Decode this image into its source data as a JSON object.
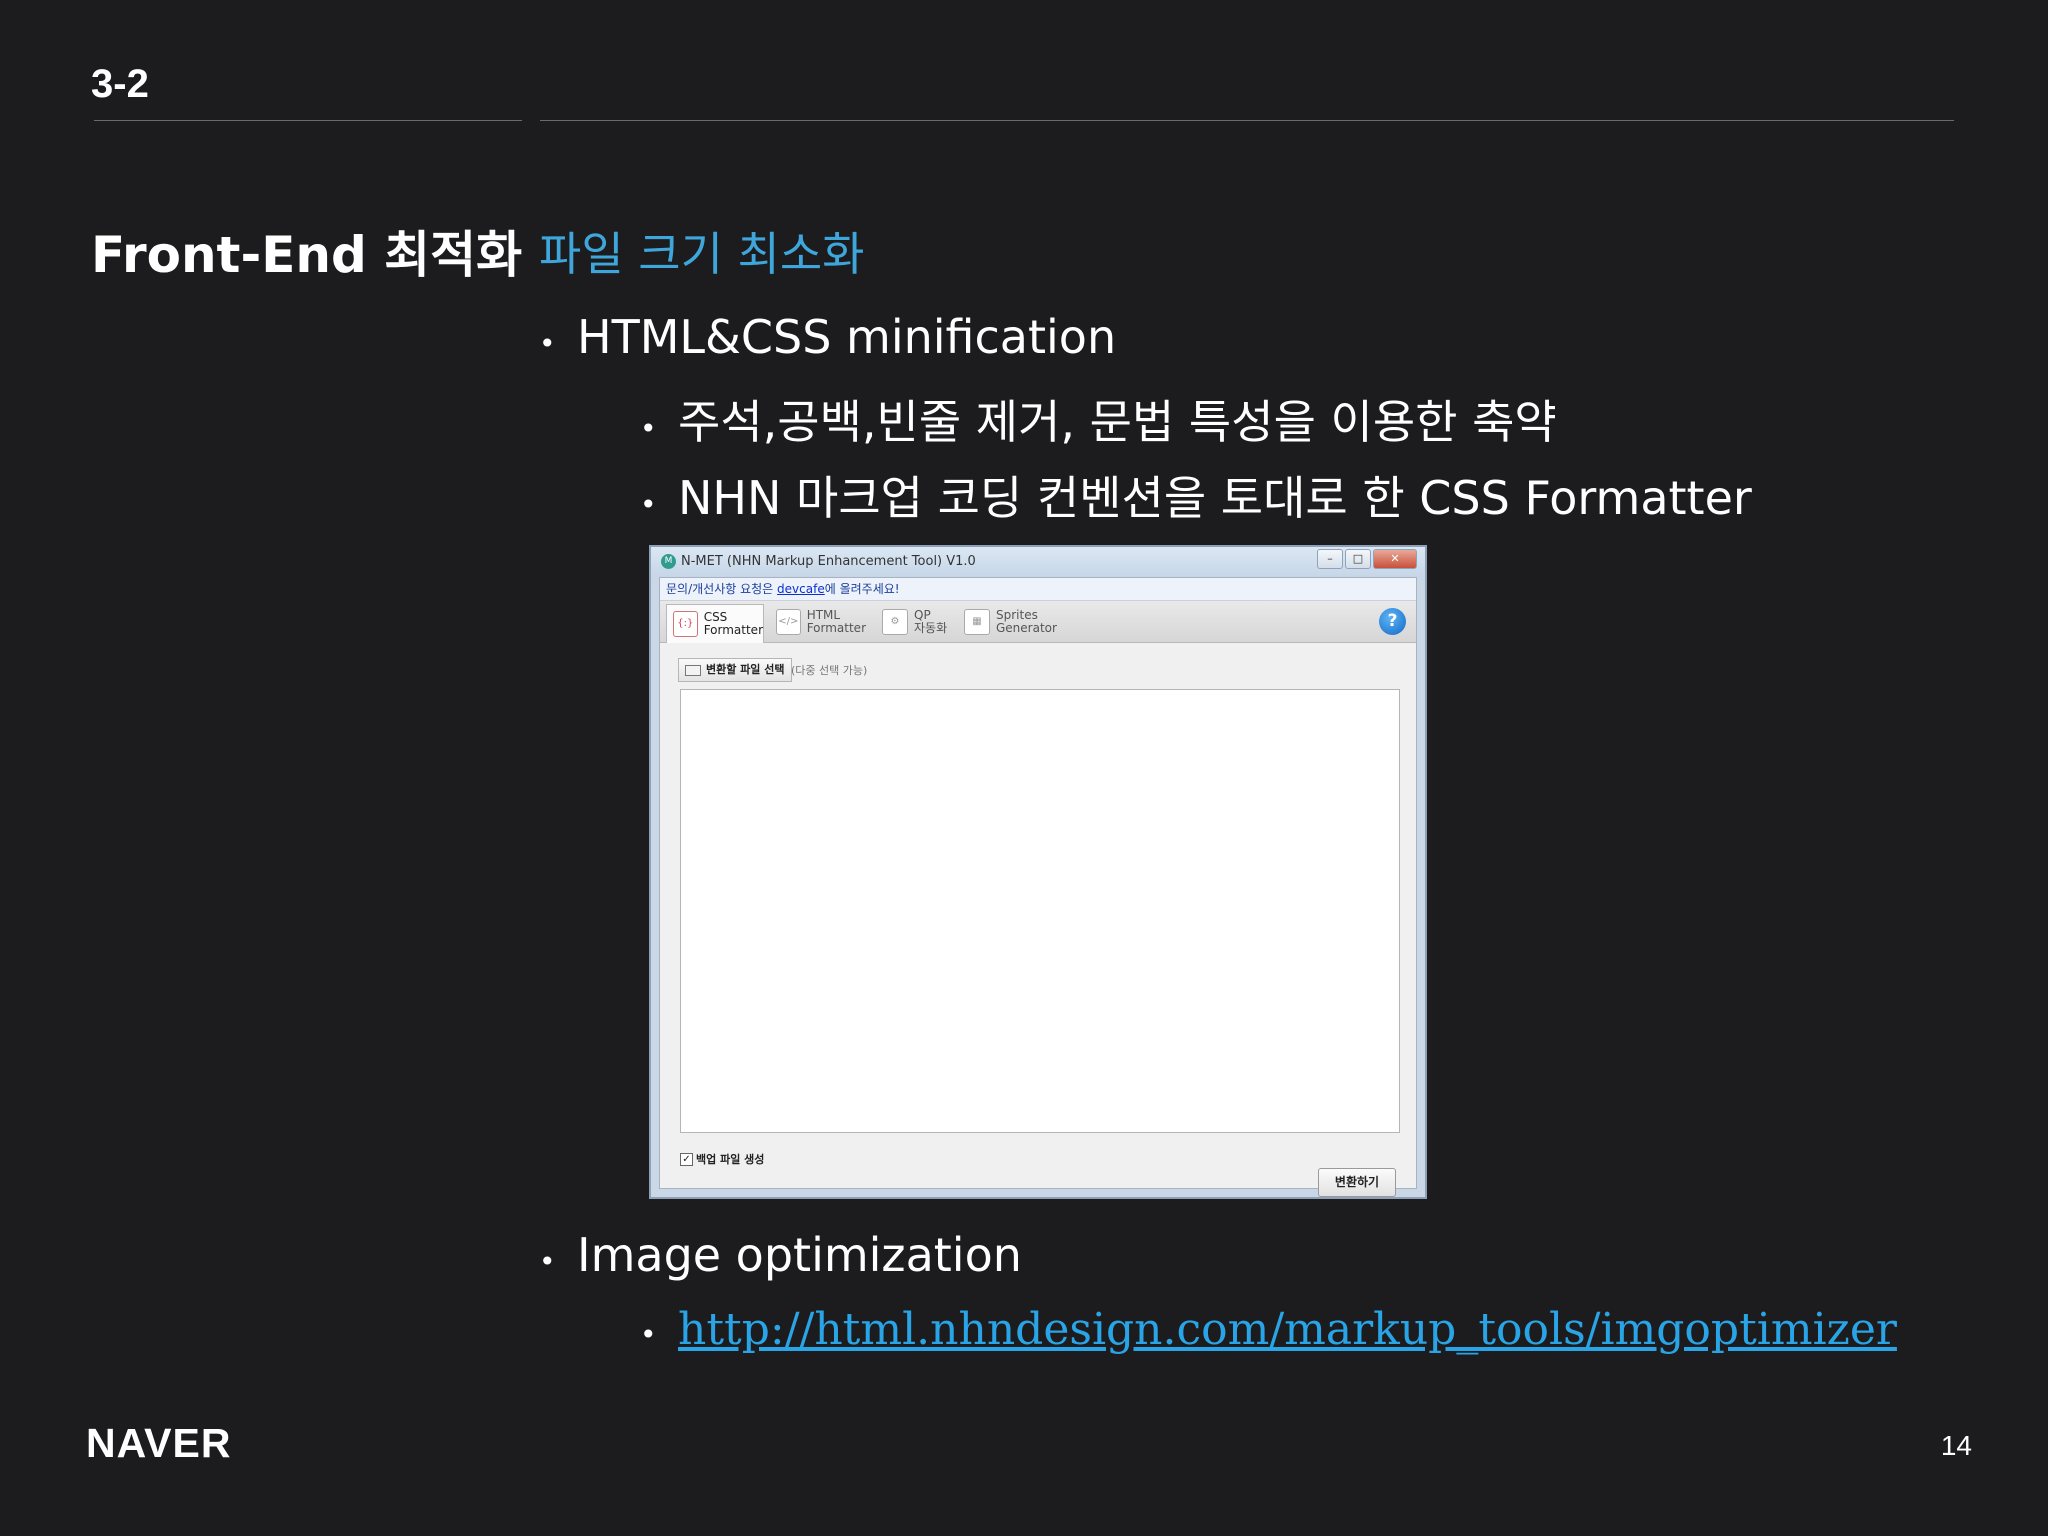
{
  "header": {
    "section_number": "3-2"
  },
  "slide": {
    "title": "Front-End 최적화",
    "subtitle": "파일 크기 최소화",
    "bullets": {
      "b1": "HTML&CSS minification",
      "b1_1": "주석,공백,빈줄 제거, 문법 특성을 이용한 축약",
      "b1_2": "NHN 마크업 코딩 컨벤션을 토대로 한 CSS Formatter",
      "b2": "Image optimization",
      "b2_1_link": "http://html.nhndesign.com/markup_tools/imgoptimizer"
    },
    "bullet_glyph": "•"
  },
  "app_window": {
    "title": "N-MET (NHN Markup Enhancement Tool) V1.0",
    "app_icon_text": "M",
    "controls": {
      "minimize": "–",
      "maximize": "□",
      "close": "✕"
    },
    "notice_prefix": "문의/개선사항 요청은 ",
    "notice_link": "devcafe",
    "notice_suffix": "에 올려주세요!",
    "tabs": [
      {
        "label": "CSS\nFormatter",
        "icon": "{:}"
      },
      {
        "label": "HTML\nFormatter",
        "icon": "</>"
      },
      {
        "label": "QP\n자동화",
        "icon": "⚙"
      },
      {
        "label": "Sprites\nGenerator",
        "icon": "▦"
      }
    ],
    "help_label": "?",
    "select_file_button": "변환할 파일 선택",
    "multi_select_hint": "(다중 선택 가능)",
    "backup_checkbox_label": "백업 파일 생성",
    "backup_checked": "✓",
    "convert_button": "변환하기"
  },
  "footer": {
    "logo": "NAVER",
    "page_number": "14"
  },
  "colors": {
    "background": "#1c1c1e",
    "accent": "#3fa6db",
    "link": "#29a4e6"
  }
}
